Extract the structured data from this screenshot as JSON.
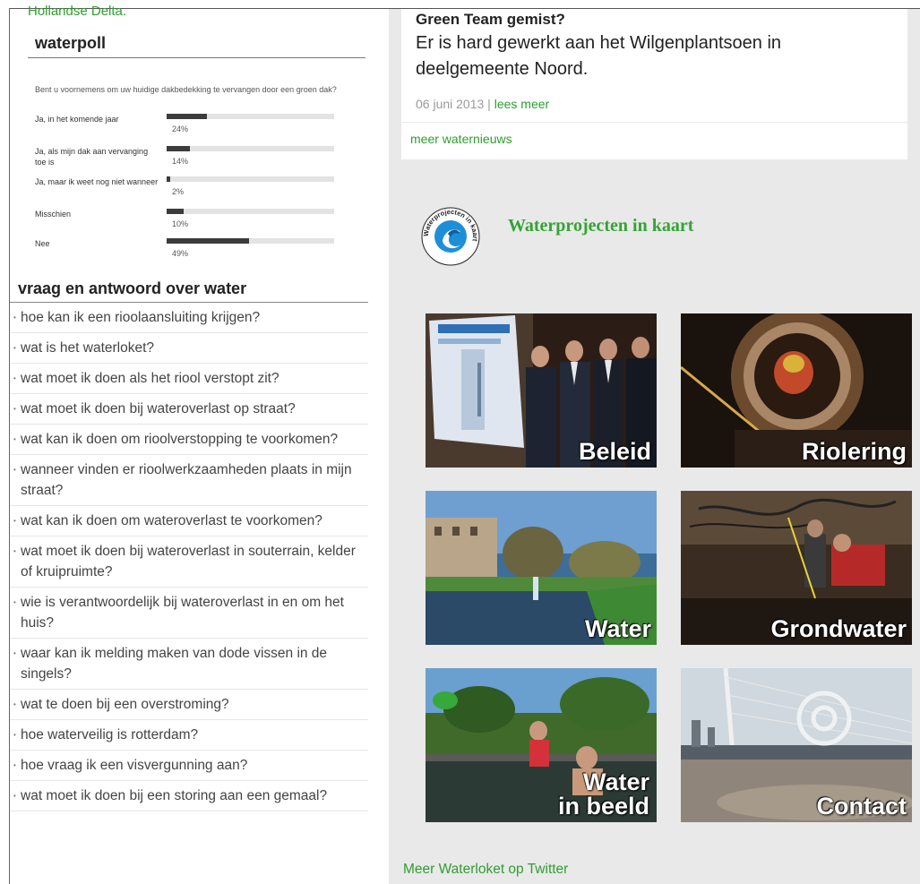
{
  "cut_link": "Hollandse Delta.",
  "poll": {
    "title": "waterpoll",
    "question": "Bent u voornemens om uw huidige dakbedekking te vervangen door een groen dak?",
    "options": [
      {
        "label": "Ja, in het komende jaar",
        "percent": 24,
        "pct_text": "24%"
      },
      {
        "label": "Ja, als mijn dak aan vervanging toe is",
        "percent": 14,
        "pct_text": "14%"
      },
      {
        "label": "Ja, maar ik weet nog niet wanneer",
        "percent": 2,
        "pct_text": "2%"
      },
      {
        "label": "Misschien",
        "percent": 10,
        "pct_text": "10%"
      },
      {
        "label": "Nee",
        "percent": 49,
        "pct_text": "49%"
      }
    ]
  },
  "faq": {
    "title": "vraag en antwoord over water",
    "items": [
      "hoe kan ik een rioolaansluiting krijgen?",
      "wat is het waterloket?",
      "wat moet ik doen als het riool verstopt zit?",
      "wat moet ik doen bij wateroverlast op straat?",
      "wat kan ik doen om rioolverstopping te voorkomen?",
      "wanneer vinden er rioolwerkzaamheden plaats in mijn straat?",
      "wat kan ik doen om wateroverlast te voorkomen?",
      "wat moet ik doen bij wateroverlast in souterrain, kelder of kruipruimte?",
      "wie is verantwoordelijk bij wateroverlast in en om het huis?",
      "waar kan ik melding maken van dode vissen in de singels?",
      "wat te doen bij een overstroming?",
      "hoe waterveilig is rotterdam?",
      "hoe vraag ik een visvergunning aan?",
      "wat moet ik doen bij een storing aan een gemaal?"
    ]
  },
  "news": {
    "title": "Green Team gemist?",
    "text": "Er is hard gewerkt aan het Wilgenplantsoen in deelgemeente Noord.",
    "date": "06 juni 2013",
    "separator": " | ",
    "more_label": "lees meer",
    "more_news": "meer waternieuws"
  },
  "waterprojects": {
    "logo_text": "Waterprojecten in kaart",
    "title": "Waterprojecten in kaart"
  },
  "tiles": [
    {
      "label": "Beleid"
    },
    {
      "label": "Riolering"
    },
    {
      "label": "Water"
    },
    {
      "label": "Grondwater"
    },
    {
      "label_line1": "Water",
      "label_line2": "in beeld"
    },
    {
      "label": "Contact"
    }
  ],
  "twitter_link": "Meer Waterloket op Twitter",
  "colors": {
    "link_green": "#2f9e2f",
    "title_green": "#35a335",
    "bar_fill": "#3c3c3c",
    "bar_track": "#e3e3e3",
    "right_bg": "#e9e9e9"
  }
}
